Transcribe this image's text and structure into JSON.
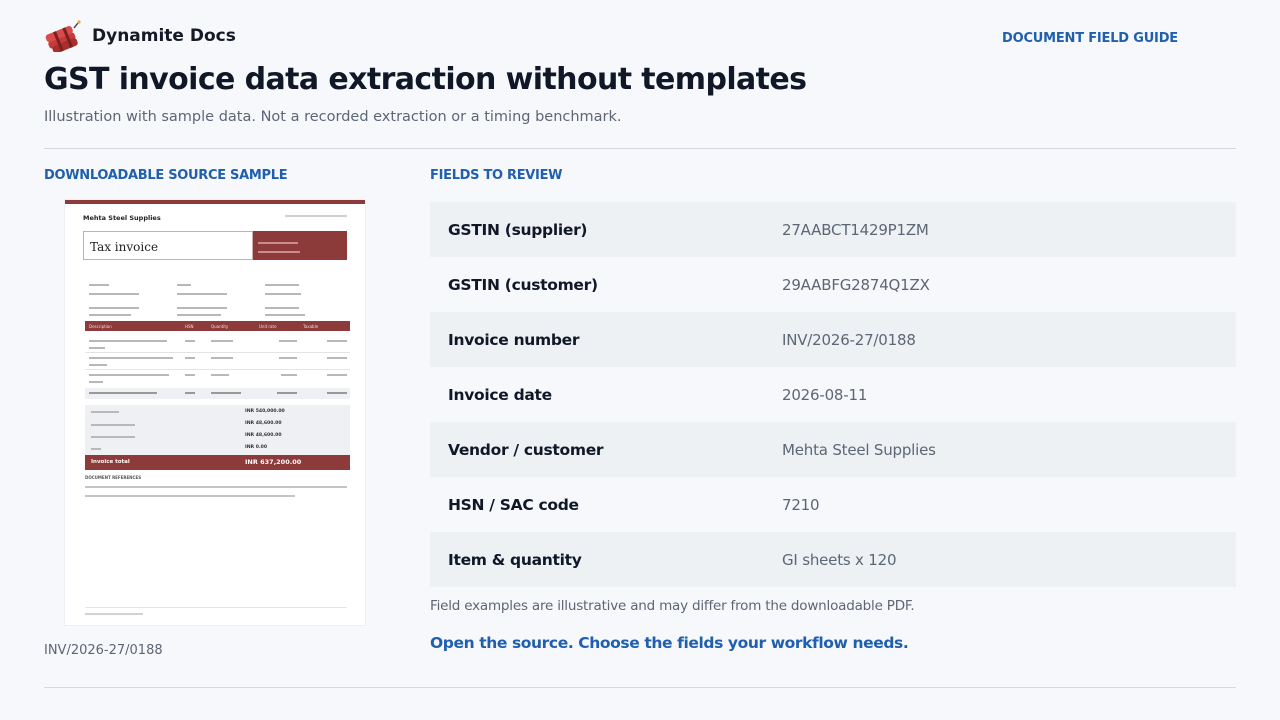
{
  "brand": {
    "name": "Dynamite Docs",
    "logo_icon": "dynamite-icon"
  },
  "nav": {
    "guide_link": "DOCUMENT FIELD GUIDE"
  },
  "header": {
    "title": "GST invoice data extraction without templates",
    "subtitle": "Illustration with sample data. Not a recorded extraction or a timing benchmark."
  },
  "source": {
    "label": "DOWNLOADABLE SOURCE SAMPLE",
    "sample_id": "INV/2026-27/0188",
    "preview": {
      "company": "Mehta Steel Supplies",
      "doc_title": "Tax invoice",
      "invoice_total_label": "Invoice total",
      "invoice_total_value": "INR 637,200.00",
      "column_headers": [
        "Description",
        "HSN",
        "Quantity",
        "Unit rate",
        "Taxable"
      ],
      "summary_values": [
        "INR 540,000.00",
        "INR 48,600.00",
        "INR 48,600.00",
        "INR 0.00"
      ],
      "notes_label": "DOCUMENT REFERENCES"
    }
  },
  "fields": {
    "label": "FIELDS TO REVIEW",
    "rows": [
      {
        "name": "GSTIN (supplier)",
        "value": "27AABCT1429P1ZM"
      },
      {
        "name": "GSTIN (customer)",
        "value": "29AABFG2874Q1ZX"
      },
      {
        "name": "Invoice number",
        "value": "INV/2026-27/0188"
      },
      {
        "name": "Invoice date",
        "value": "2026-08-11"
      },
      {
        "name": "Vendor / customer",
        "value": "Mehta Steel Supplies"
      },
      {
        "name": "HSN / SAC code",
        "value": "7210"
      },
      {
        "name": "Item & quantity",
        "value": "GI sheets x 120"
      }
    ],
    "note": "Field examples are illustrative and may differ from the downloadable PDF.",
    "cta": "Open the source. Choose the fields your workflow needs."
  },
  "colors": {
    "accent": "#1f5fae",
    "document_accent": "#8c3a3a",
    "background": "#f6f8fb"
  }
}
